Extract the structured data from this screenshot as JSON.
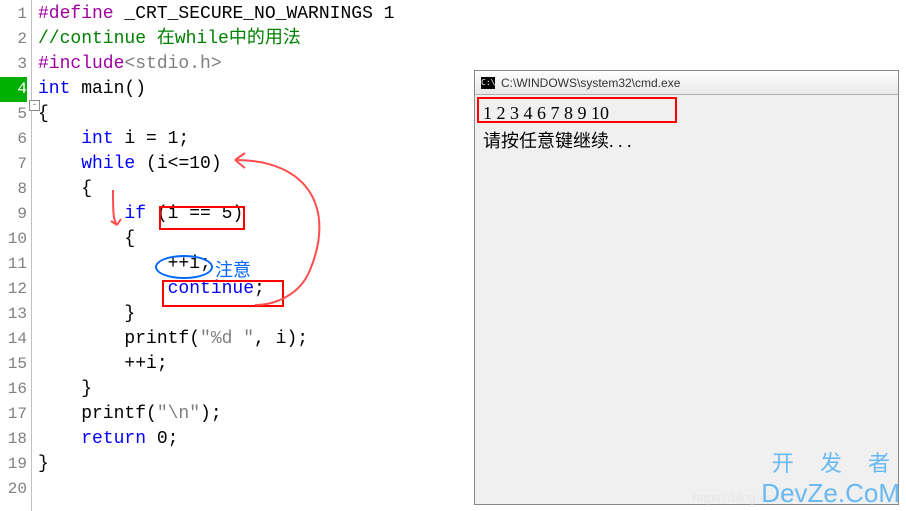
{
  "gutter": {
    "lines": [
      "1",
      "2",
      "3",
      "4",
      "5",
      "6",
      "7",
      "8",
      "9",
      "10",
      "11",
      "12",
      "13",
      "14",
      "15",
      "16",
      "17",
      "18",
      "19",
      "20"
    ],
    "cursor": 4
  },
  "code": {
    "l1": {
      "a": "#define",
      "b": " _CRT_SECURE_NO_WARNINGS 1"
    },
    "l2": "//continue 在while中的用法",
    "l3": {
      "a": "#include",
      "b": "<stdio.h>"
    },
    "l4": {
      "a": "int",
      "b": " main()"
    },
    "l5": "{",
    "l6": {
      "a": "    ",
      "b": "int",
      "c": " i = 1;"
    },
    "l7": {
      "a": "    ",
      "b": "while",
      "c": " (i<=10)"
    },
    "l8": "    {",
    "l9": {
      "a": "        ",
      "b": "if",
      "c": " (i == 5)"
    },
    "l10": "        {",
    "l11": {
      "a": "            ",
      "b": "++i;"
    },
    "l12": {
      "a": "            ",
      "b": "continue",
      "c": ";"
    },
    "l13": "        }",
    "l14": {
      "a": "        printf(",
      "b": "\"%d \"",
      "c": ", i);"
    },
    "l15": "        ++i;",
    "l16": "    }",
    "l17": {
      "a": "    printf(",
      "b": "\"\\n\"",
      "c": ");"
    },
    "l18": {
      "a": "    ",
      "b": "return",
      "c": " 0;"
    },
    "l19": "}"
  },
  "annotations": {
    "note_label": "注意"
  },
  "console": {
    "title": "C:\\WINDOWS\\system32\\cmd.exe",
    "icon": "C:\\",
    "output": "1 2 3 4 6 7 8 9 10",
    "prompt": "请按任意键继续. . ."
  },
  "watermark": {
    "url": "https://blog.csdn.n",
    "brand_cn": "开 发 者",
    "brand_en": "DevZe.CoM"
  }
}
